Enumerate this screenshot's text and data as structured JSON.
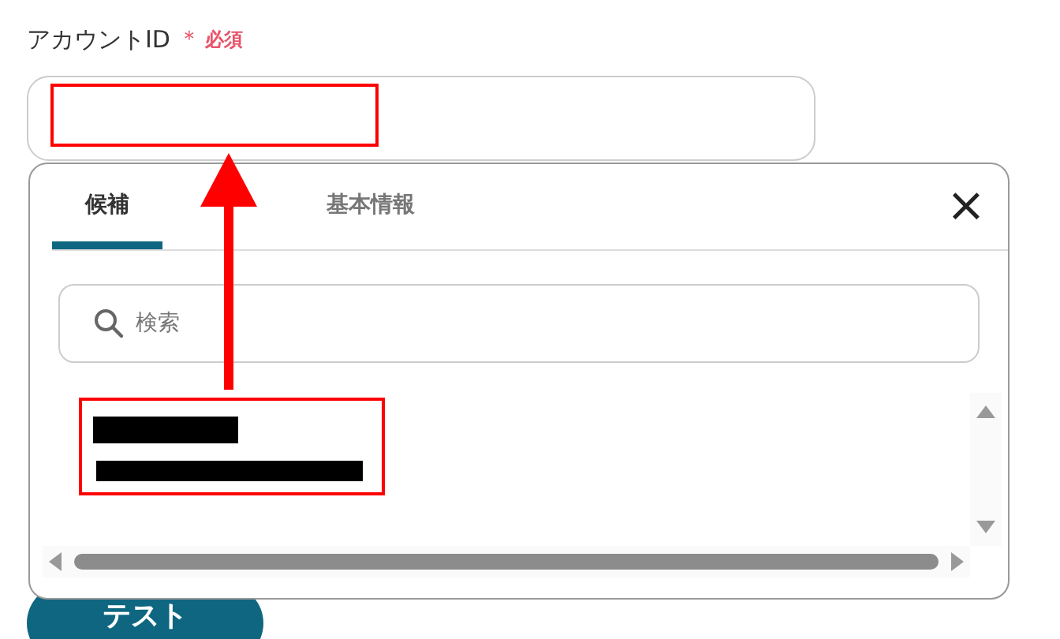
{
  "field": {
    "label": "アカウントID",
    "required_mark": "＊",
    "required_text": "必須"
  },
  "popup": {
    "tabs": [
      {
        "label": "候補",
        "selected": true
      },
      {
        "label": "基本情報",
        "selected": false
      }
    ],
    "close": "×",
    "search": {
      "placeholder": "検索"
    }
  },
  "button": "テスト"
}
